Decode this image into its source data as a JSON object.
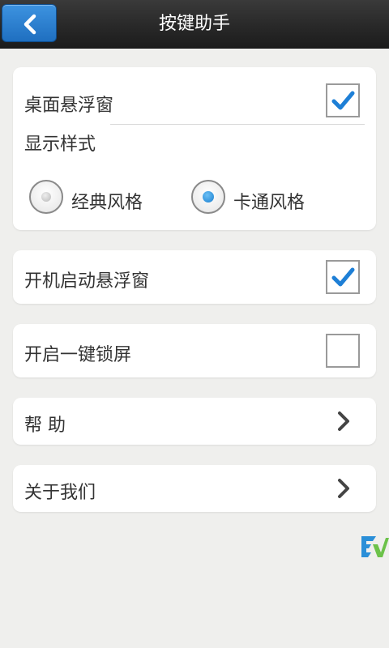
{
  "header": {
    "title": "按键助手"
  },
  "settings": {
    "floating_window": {
      "label": "桌面悬浮窗",
      "checked": true
    },
    "display_style": {
      "label": "显示样式",
      "options": [
        {
          "label": "经典风格",
          "selected": false
        },
        {
          "label": "卡通风格",
          "selected": true
        }
      ]
    },
    "boot_floating": {
      "label": "开机启动悬浮窗",
      "checked": true
    },
    "one_key_lock": {
      "label": "开启一键锁屏",
      "checked": false
    },
    "help": {
      "label": "帮 助"
    },
    "about": {
      "label": "关于我们"
    }
  },
  "colors": {
    "accent": "#1e7fd6",
    "titlebar": "#2a2a2a",
    "background": "#efefed"
  }
}
